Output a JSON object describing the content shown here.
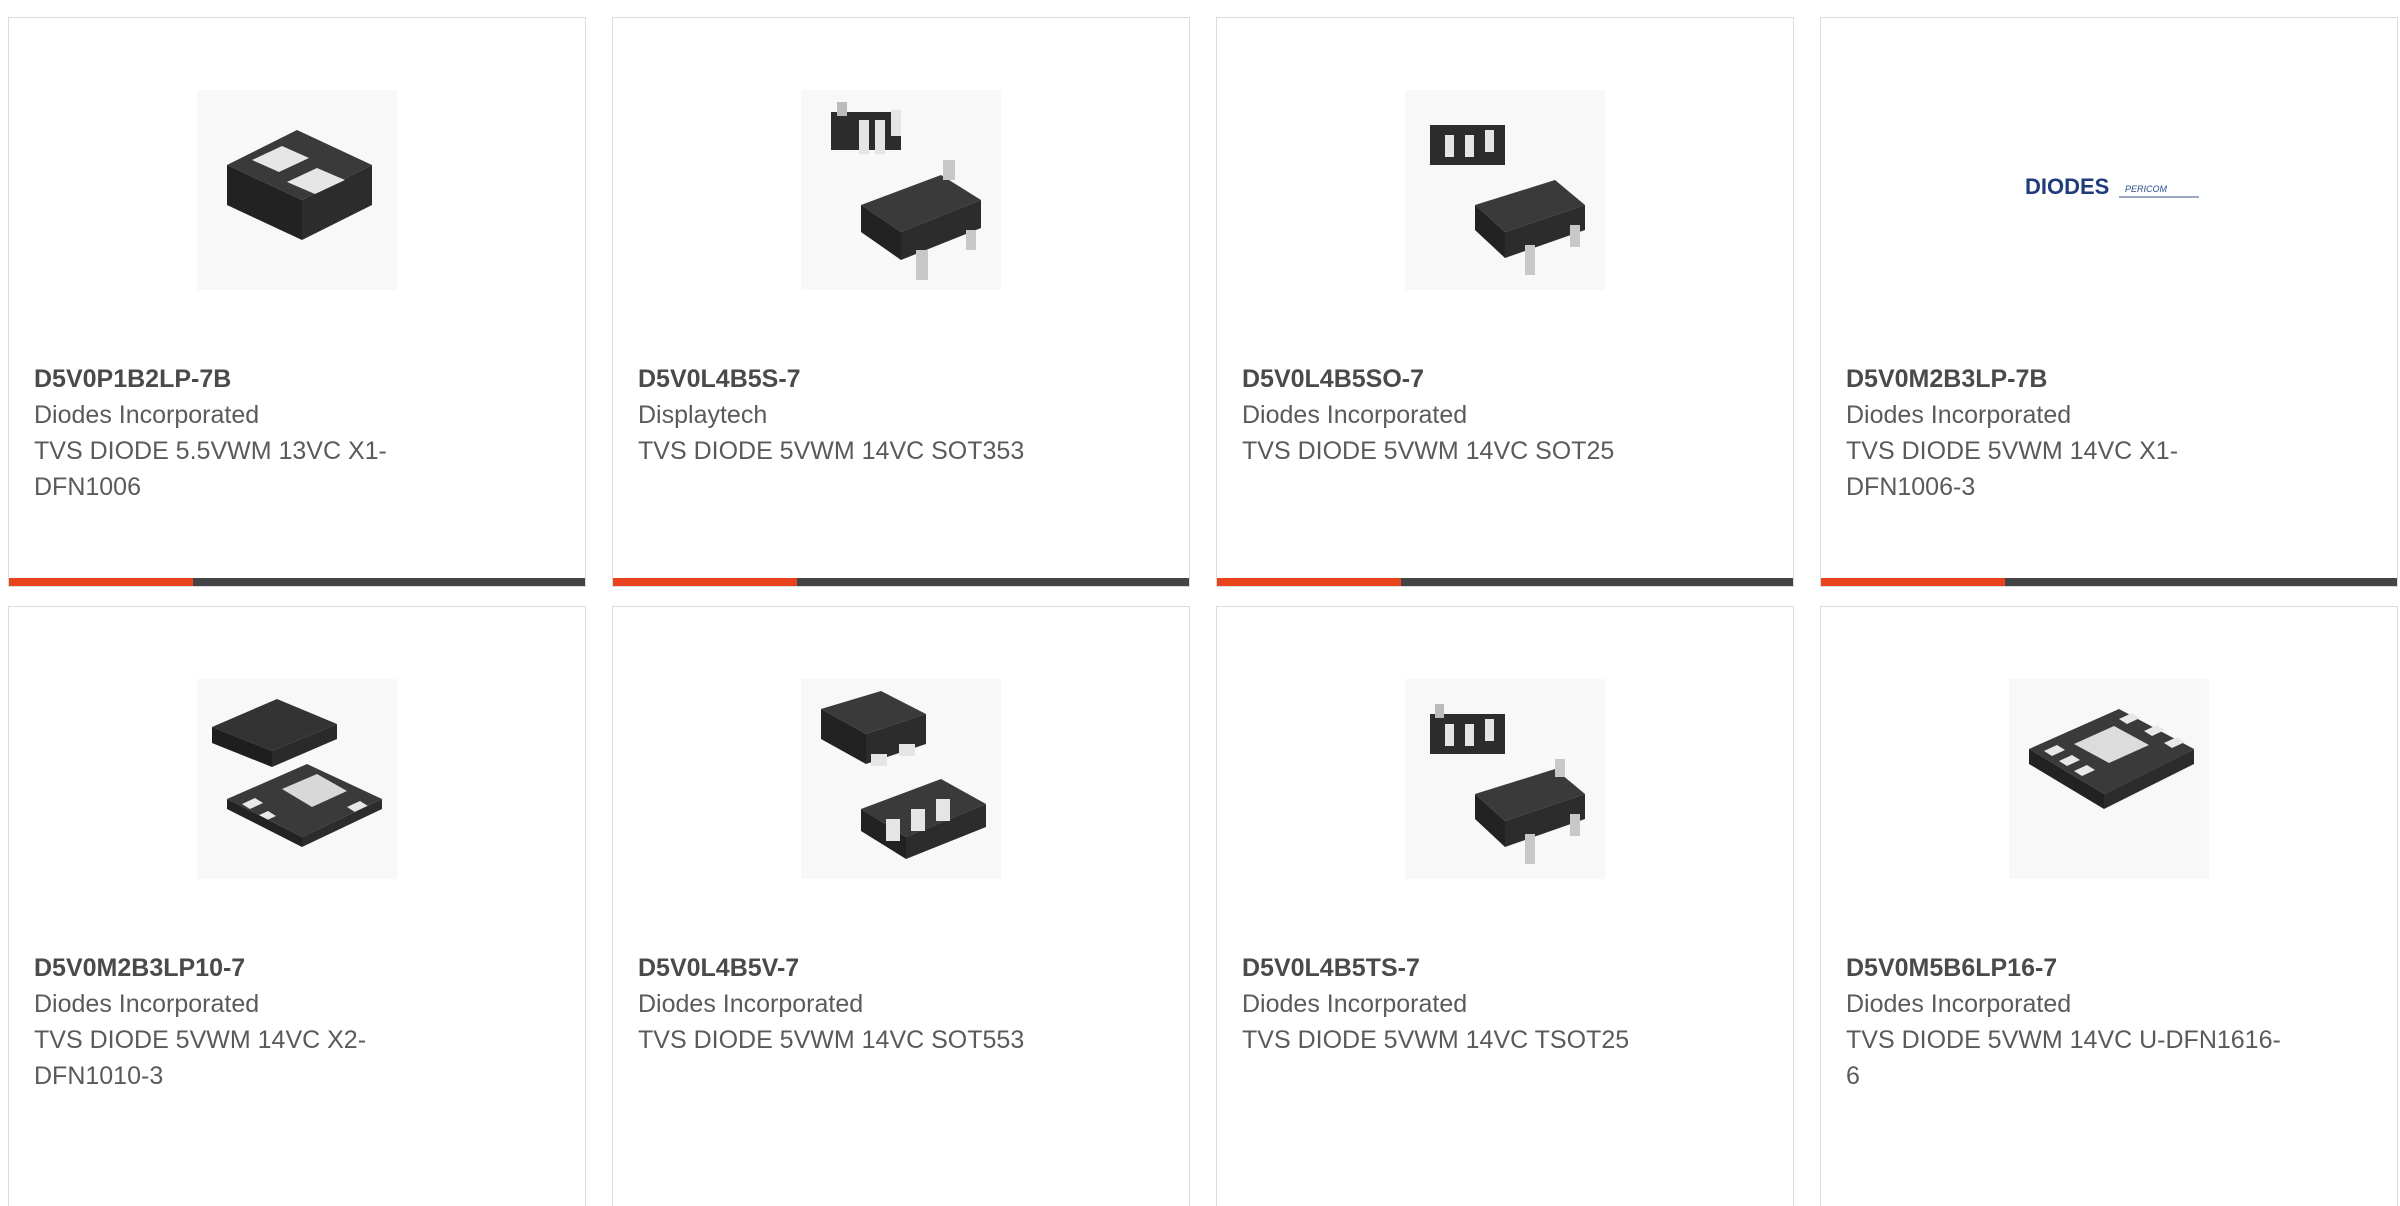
{
  "colors": {
    "accent": "#e8431d",
    "bar": "#444444",
    "text": "#5a5a5a",
    "border": "#dcdcdc"
  },
  "products": [
    {
      "part": "D5V0P1B2LP-7B",
      "maker": "Diodes Incorporated",
      "desc": "TVS DIODE 5.5VWM 13VC X1-DFN1006",
      "image": "dfn-2pad-package-icon"
    },
    {
      "part": "D5V0L4B5S-7",
      "maker": "Displaytech",
      "desc": "TVS DIODE 5VWM 14VC SOT353",
      "image": "sot353-package-icon"
    },
    {
      "part": "D5V0L4B5SO-7",
      "maker": "Diodes Incorporated",
      "desc": "TVS DIODE 5VWM 14VC SOT25",
      "image": "sot25-package-icon"
    },
    {
      "part": "D5V0M2B3LP-7B",
      "maker": "Diodes Incorporated",
      "desc": "TVS DIODE 5VWM 14VC X1-DFN1006-3",
      "image": "diodes-pericom-logo",
      "logo_text": "DIODES",
      "logo_subtext": "PERICOM"
    },
    {
      "part": "D5V0M2B3LP10-7",
      "maker": "Diodes Incorporated",
      "desc": "TVS DIODE 5VWM 14VC X2-DFN1010-3",
      "image": "dfn1010-package-icon"
    },
    {
      "part": "D5V0L4B5V-7",
      "maker": "Diodes Incorporated",
      "desc": "TVS DIODE 5VWM 14VC SOT553",
      "image": "sot553-package-icon"
    },
    {
      "part": "D5V0L4B5TS-7",
      "maker": "Diodes Incorporated",
      "desc": "TVS DIODE 5VWM 14VC TSOT25",
      "image": "tsot25-package-icon"
    },
    {
      "part": "D5V0M5B6LP16-7",
      "maker": "Diodes Incorporated",
      "desc": "TVS DIODE 5VWM 14VC U-DFN1616-6",
      "image": "dfn1616-package-icon"
    }
  ]
}
